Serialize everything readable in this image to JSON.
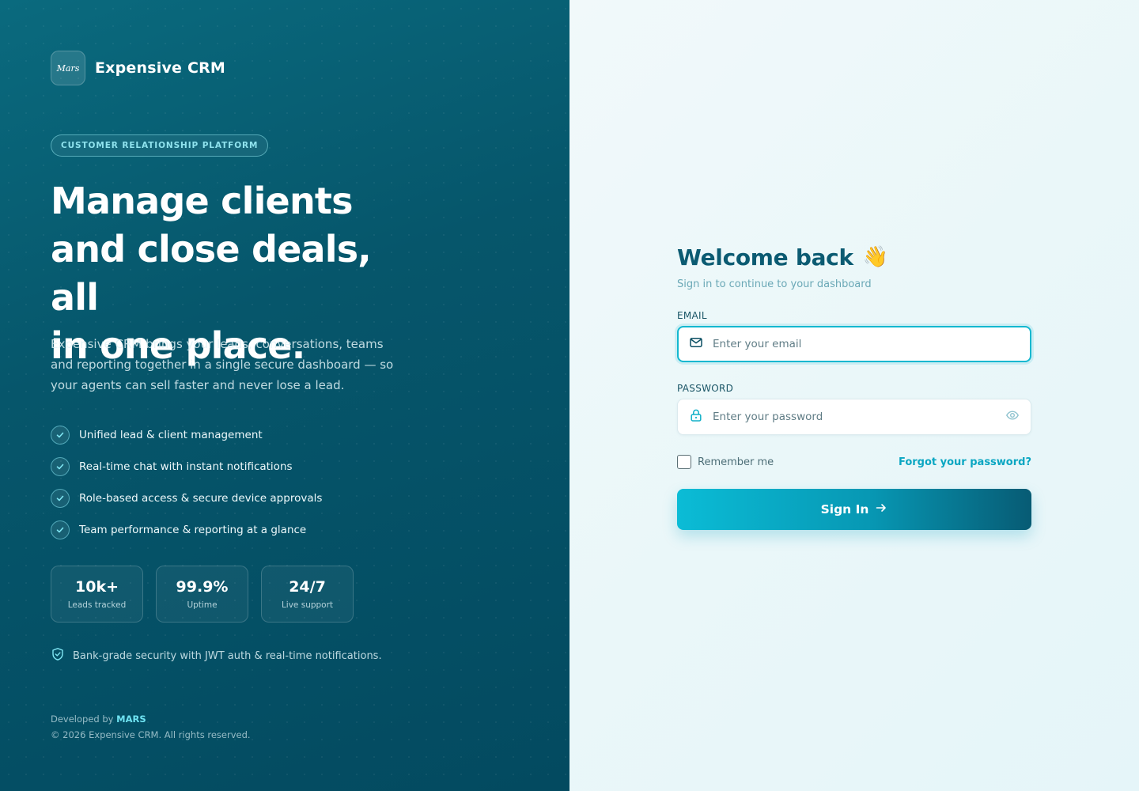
{
  "brand": {
    "name": "Expensive CRM",
    "logo_text": "Mars"
  },
  "badge": "CUSTOMER RELATIONSHIP PLATFORM",
  "hero": {
    "line1": "Manage clients",
    "line2": "and close deals, all",
    "line3": "in one place."
  },
  "lead": "Expensive CRM brings your leads, conversations, teams and reporting together in a single secure dashboard — so your agents can sell faster and never lose a lead.",
  "features": [
    "Unified lead & client management",
    "Real-time chat with instant notifications",
    "Role-based access & secure device approvals",
    "Team performance & reporting at a glance"
  ],
  "stats": [
    {
      "value": "10k+",
      "label": "Leads tracked"
    },
    {
      "value": "99.9%",
      "label": "Uptime"
    },
    {
      "value": "24/7",
      "label": "Live support"
    }
  ],
  "security": "Bank-grade security with JWT auth & real-time notifications.",
  "footer": {
    "developed_by": "Developed by",
    "developer": "MARS",
    "copyright": "© 2026 Expensive CRM. All rights reserved."
  },
  "login": {
    "title": "Welcome back",
    "wave_emoji": "👋",
    "subtitle": "Sign in to continue to your dashboard",
    "email_label": "EMAIL",
    "email_placeholder": "Enter your email",
    "email_value": "",
    "password_label": "PASSWORD",
    "password_placeholder": "Enter your password",
    "password_value": "",
    "remember_label": "Remember me",
    "remember_checked": false,
    "forgot_label": "Forgot your password?",
    "signin_label": "Sign In"
  },
  "icons": {
    "logo": "mars-logo-icon",
    "check": "check-icon",
    "shield": "shield-check-icon",
    "mail": "mail-icon",
    "lock": "lock-icon",
    "eye": "eye-icon",
    "arrow": "arrow-right-icon"
  },
  "colors": {
    "left_panel": "#06566b",
    "accent": "#13b8d0",
    "title": "#0b5b72",
    "link": "#0aa6c2"
  }
}
